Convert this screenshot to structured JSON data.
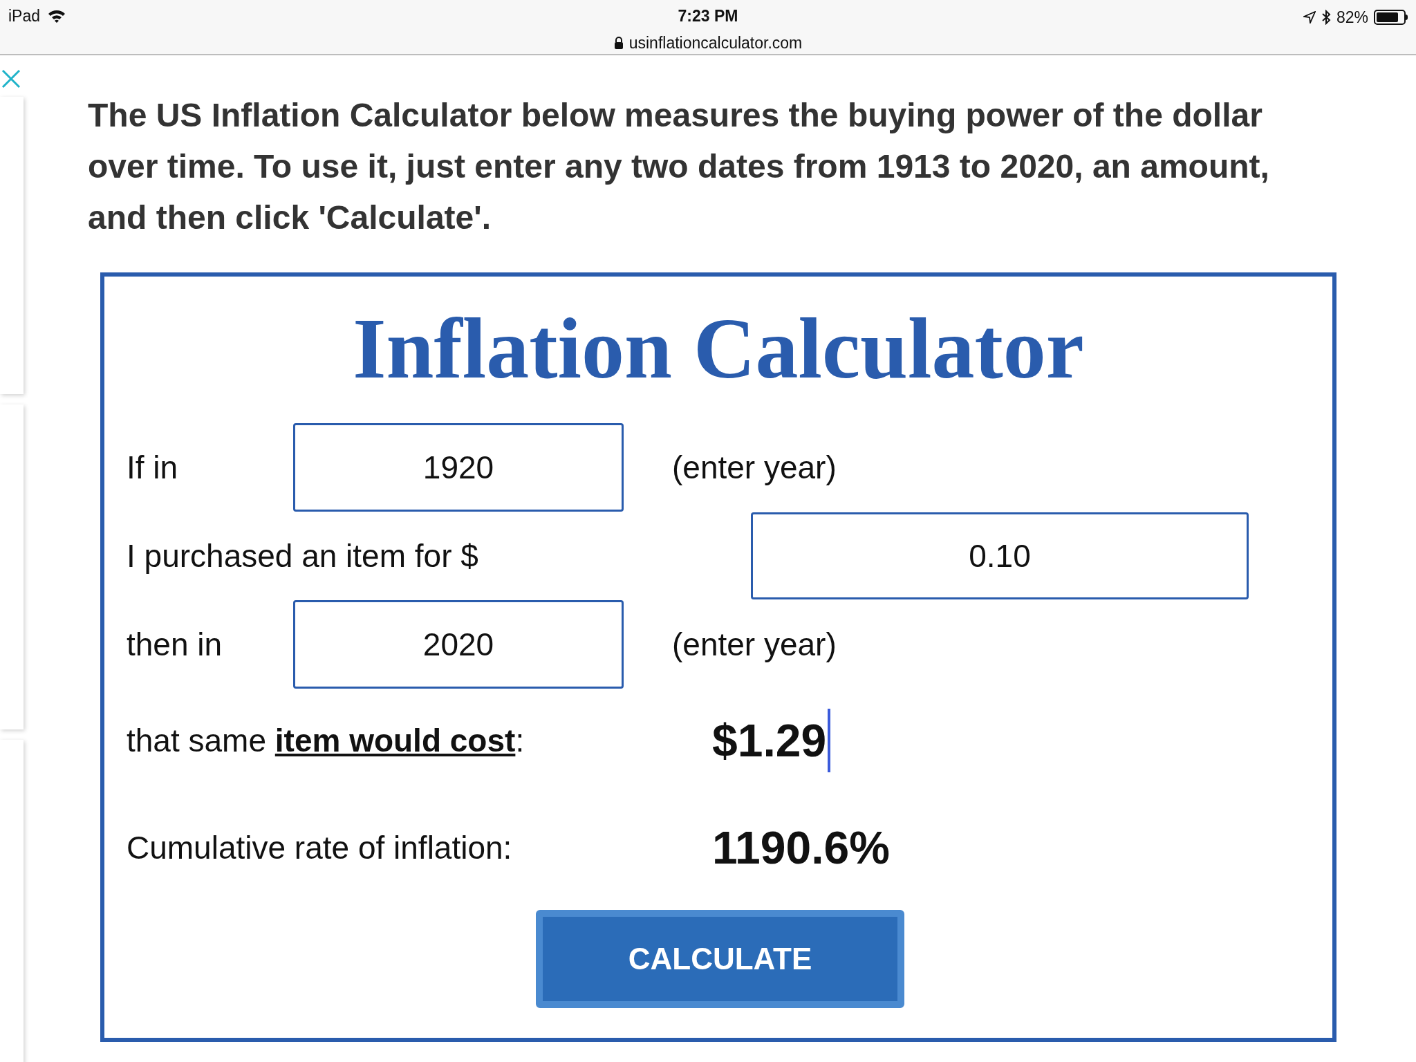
{
  "status_bar": {
    "device": "iPad",
    "time": "7:23 PM",
    "url": "usinflationcalculator.com",
    "battery": "82%"
  },
  "intro": "The US Inflation Calculator below measures the buying power of the dollar over time. To use it, just enter any two dates from 1913 to 2020, an amount, and then click 'Calculate'.",
  "calculator": {
    "title": "Inflation Calculator",
    "start_row": {
      "label": "If in",
      "value": "1920",
      "hint": "(enter year)"
    },
    "amount_row": {
      "label": "I purchased an item for $",
      "value": "0.10"
    },
    "end_row": {
      "label": "then in",
      "value": "2020",
      "hint": "(enter year)"
    },
    "cost_row": {
      "prefix": "that same ",
      "link": "item would cost",
      "suffix": ":",
      "value": "$1.29"
    },
    "rate_row": {
      "label": "Cumulative rate of inflation:",
      "value": "1190.6%"
    },
    "button": "CALCULATE"
  }
}
